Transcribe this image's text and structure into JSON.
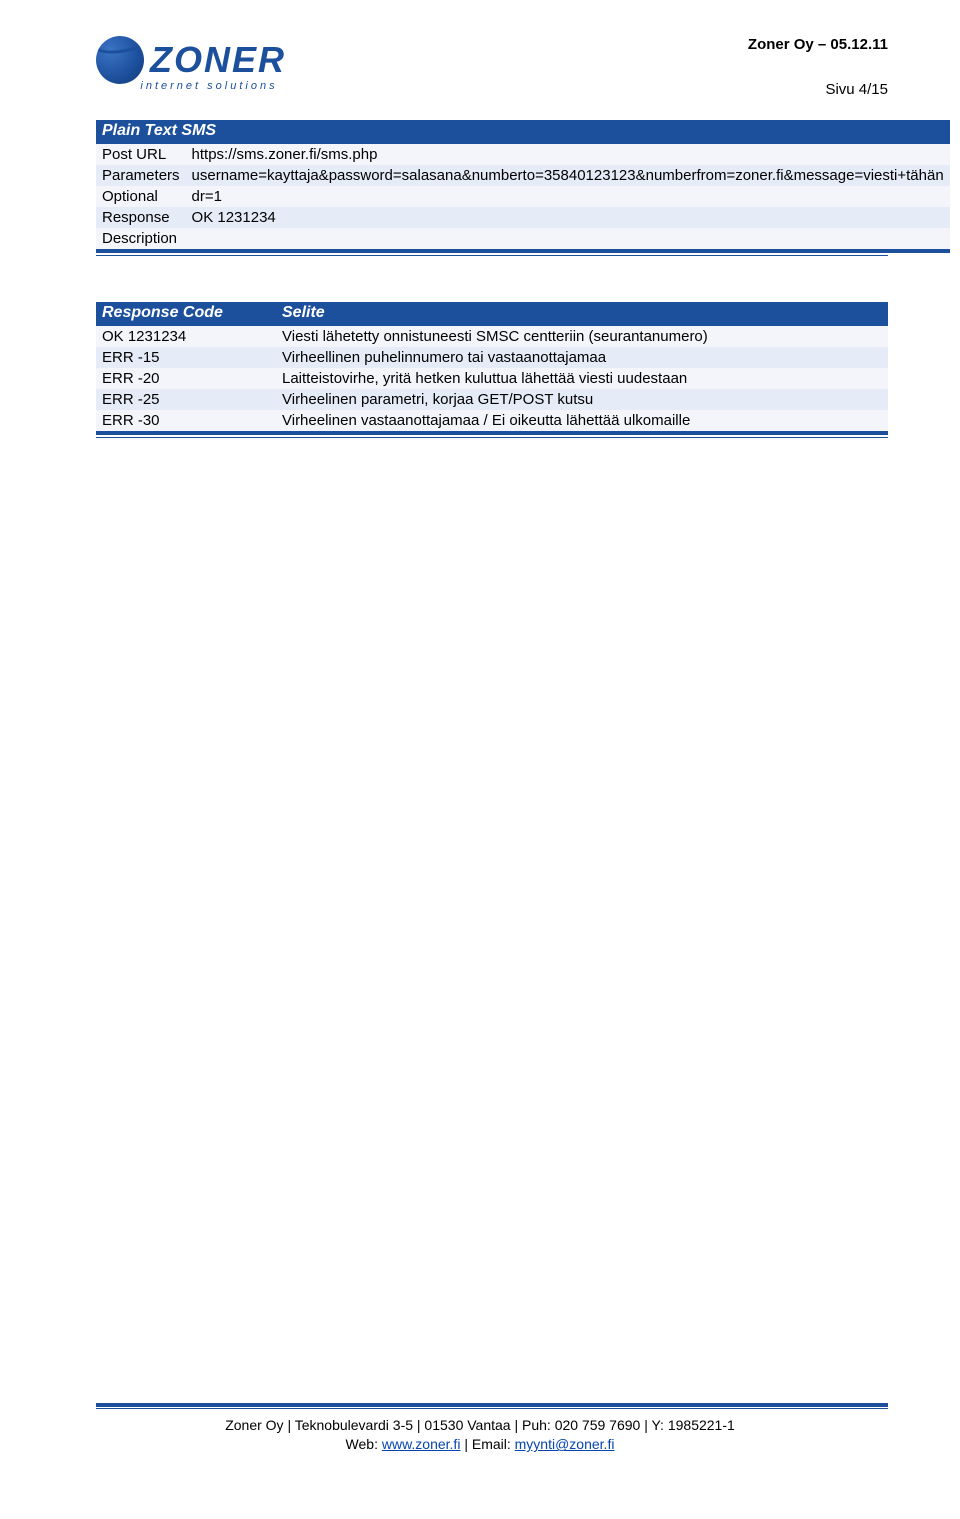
{
  "header": {
    "company_date": "Zoner Oy – 05.12.11",
    "page_label": "Sivu 4/15",
    "logo_word": "ZONER",
    "logo_sub": "internet solutions"
  },
  "table1": {
    "title": "Plain Text SMS",
    "rows": [
      {
        "label": "Post URL",
        "value": "https://sms.zoner.fi/sms.php"
      },
      {
        "label": "Parameters",
        "value": "username=kayttaja&password=salasana&numberto=35840123123&numberfrom=zoner.fi&message=viesti+tähän"
      },
      {
        "label": "Optional",
        "value": "dr=1"
      },
      {
        "label": "Response",
        "value": "OK 1231234"
      },
      {
        "label": "Description",
        "value": ""
      }
    ]
  },
  "table2": {
    "head_code": "Response Code",
    "head_desc": "Selite",
    "rows": [
      {
        "code": "OK 1231234",
        "desc": "Viesti lähetetty onnistuneesti SMSC centteriin (seurantanumero)"
      },
      {
        "code": "ERR -15",
        "desc": "Virheellinen puhelinnumero tai vastaanottajamaa"
      },
      {
        "code": "ERR -20",
        "desc": "Laitteistovirhe, yritä hetken kuluttua lähettää viesti uudestaan"
      },
      {
        "code": "ERR -25",
        "desc": "Virheelinen parametri, korjaa GET/POST kutsu"
      },
      {
        "code": "ERR -30",
        "desc": "Virheelinen vastaanottajamaa / Ei oikeutta lähettää ulkomaille"
      }
    ]
  },
  "footer": {
    "line1_pre": "Zoner Oy | Teknobulevardi 3-5 | 01530 Vantaa | Puh: 020 759 7690 | Y: 1985221-1",
    "line2_pre": "Web: ",
    "line2_link": "www.zoner.fi",
    "line2_mid": " | Email: ",
    "line2_email": "myynti@zoner.fi"
  }
}
